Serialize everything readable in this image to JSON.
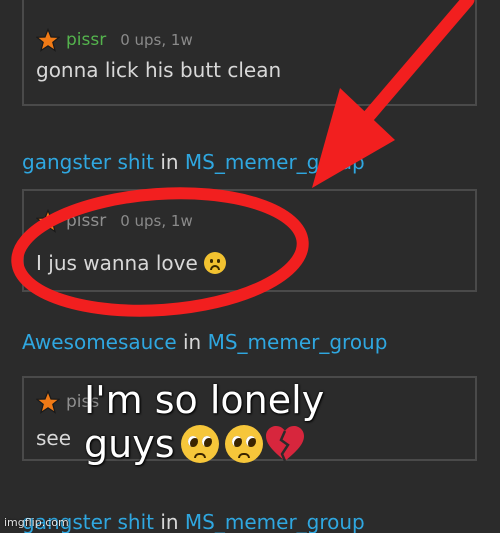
{
  "comments": [
    {
      "username": "pissr",
      "stats": "0 ups, 1w",
      "text": "gonna lick his butt clean"
    },
    {
      "username": "pissr",
      "stats": "0 ups, 1w",
      "text": "I jus wanna love",
      "emoji": "worried-face-icon"
    },
    {
      "username": "piss",
      "stats": "",
      "text": "see"
    }
  ],
  "groups": [
    {
      "author": "gangster shit",
      "in": "in",
      "group": "MS_memer_group"
    },
    {
      "author": "Awesomesauce",
      "in": "in",
      "group": "MS_memer_group"
    },
    {
      "author": "gangster shit",
      "in": "in",
      "group": "MS_memer_group"
    }
  ],
  "caption": {
    "line1": "I'm so lonely",
    "line2": "guys",
    "emojis": [
      "pleading-face-icon",
      "pleading-face-icon",
      "broken-heart-icon"
    ]
  },
  "watermark": "imgflip.com",
  "colors": {
    "background": "#2b2b2b",
    "link": "#2fa7e0",
    "username_green": "#54b34d",
    "annotation_red": "#f21f1f",
    "star_orange": "#f07a16"
  }
}
